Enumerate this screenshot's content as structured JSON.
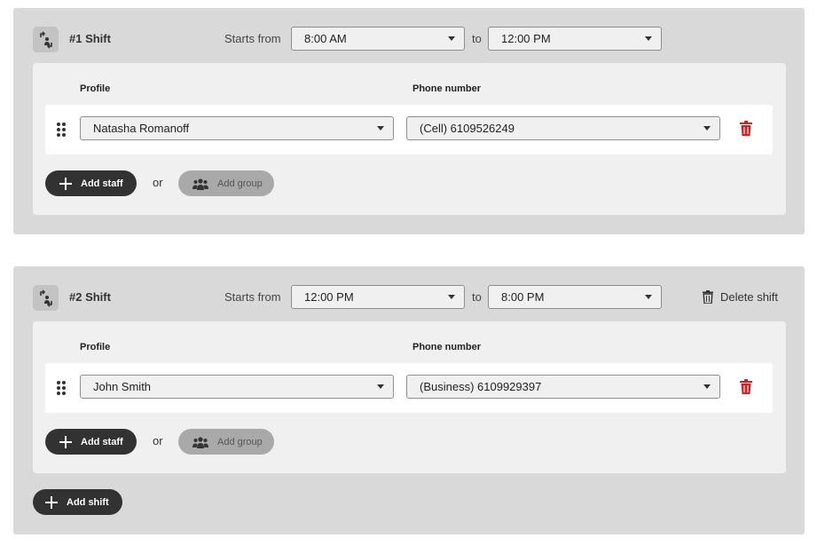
{
  "shifts": [
    {
      "title": "#1 Shift",
      "starts_from_label": "Starts from",
      "from_time": "8:00 AM",
      "to_label": "to",
      "to_time": "12:00 PM",
      "delete_label": "",
      "profile_header": "Profile",
      "phone_header": "Phone number",
      "staff": [
        {
          "profile": "Natasha Romanoff",
          "phone": "(Cell) 6109526249"
        }
      ],
      "add_staff_label": "Add staff",
      "or_label": "or",
      "add_group_label": "Add group"
    },
    {
      "title": "#2 Shift",
      "starts_from_label": "Starts from",
      "from_time": "12:00 PM",
      "to_label": "to",
      "to_time": "8:00 PM",
      "delete_label": "Delete shift",
      "profile_header": "Profile",
      "phone_header": "Phone number",
      "staff": [
        {
          "profile": "John Smith",
          "phone": "(Business) 6109929397"
        }
      ],
      "add_staff_label": "Add staff",
      "or_label": "or",
      "add_group_label": "Add group"
    }
  ],
  "add_shift_label": "Add shift",
  "icons": {
    "shift": "swap-person-icon",
    "drag": "drag-handle-icon",
    "trash": "trash-icon",
    "plus": "plus-icon",
    "group": "group-icon"
  },
  "colors": {
    "trash_red": "#c62828",
    "dark_button": "#323232",
    "disabled_button": "#a9a9a9"
  }
}
